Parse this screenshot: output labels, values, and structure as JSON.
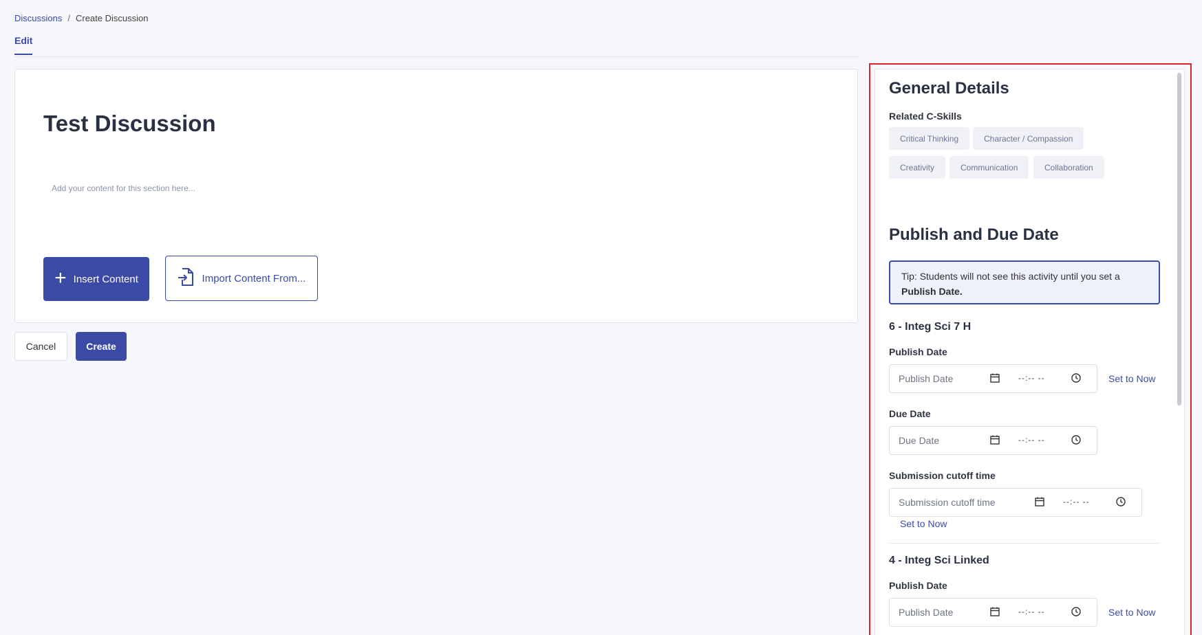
{
  "breadcrumb": {
    "root": "Discussions",
    "separator": "/",
    "current": "Create Discussion"
  },
  "tabs": {
    "edit": "Edit"
  },
  "editor": {
    "title": "Test Discussion",
    "placeholder": "Add your content for this section here...",
    "insert_label": "Insert Content",
    "import_label": "Import Content From..."
  },
  "actions": {
    "cancel": "Cancel",
    "create": "Create"
  },
  "panel": {
    "general_title": "General Details",
    "skills_label": "Related C-Skills",
    "skills": [
      "Critical Thinking",
      "Character / Compassion",
      "Creativity",
      "Communication",
      "Collaboration"
    ],
    "publish_title": "Publish and Due Date",
    "tip_text": "Tip: Students will not see this activity until you set a",
    "tip_bold": "Publish Date.",
    "time_placeholder": "--:-- --",
    "set_now": "Set to Now",
    "courses": [
      {
        "name": "6 - Integ Sci 7 H",
        "publish_label": "Publish Date",
        "publish_placeholder": "Publish Date",
        "due_label": "Due Date",
        "due_placeholder": "Due Date",
        "cutoff_label": "Submission cutoff time",
        "cutoff_placeholder": "Submission cutoff time"
      },
      {
        "name": "4 - Integ Sci Linked",
        "publish_label": "Publish Date",
        "publish_placeholder": "Publish Date"
      }
    ]
  },
  "colors": {
    "accent": "#3b4aa5",
    "highlight": "#e0232c"
  },
  "icons": [
    "plus-icon",
    "file-import-icon",
    "calendar-icon",
    "clock-icon"
  ]
}
